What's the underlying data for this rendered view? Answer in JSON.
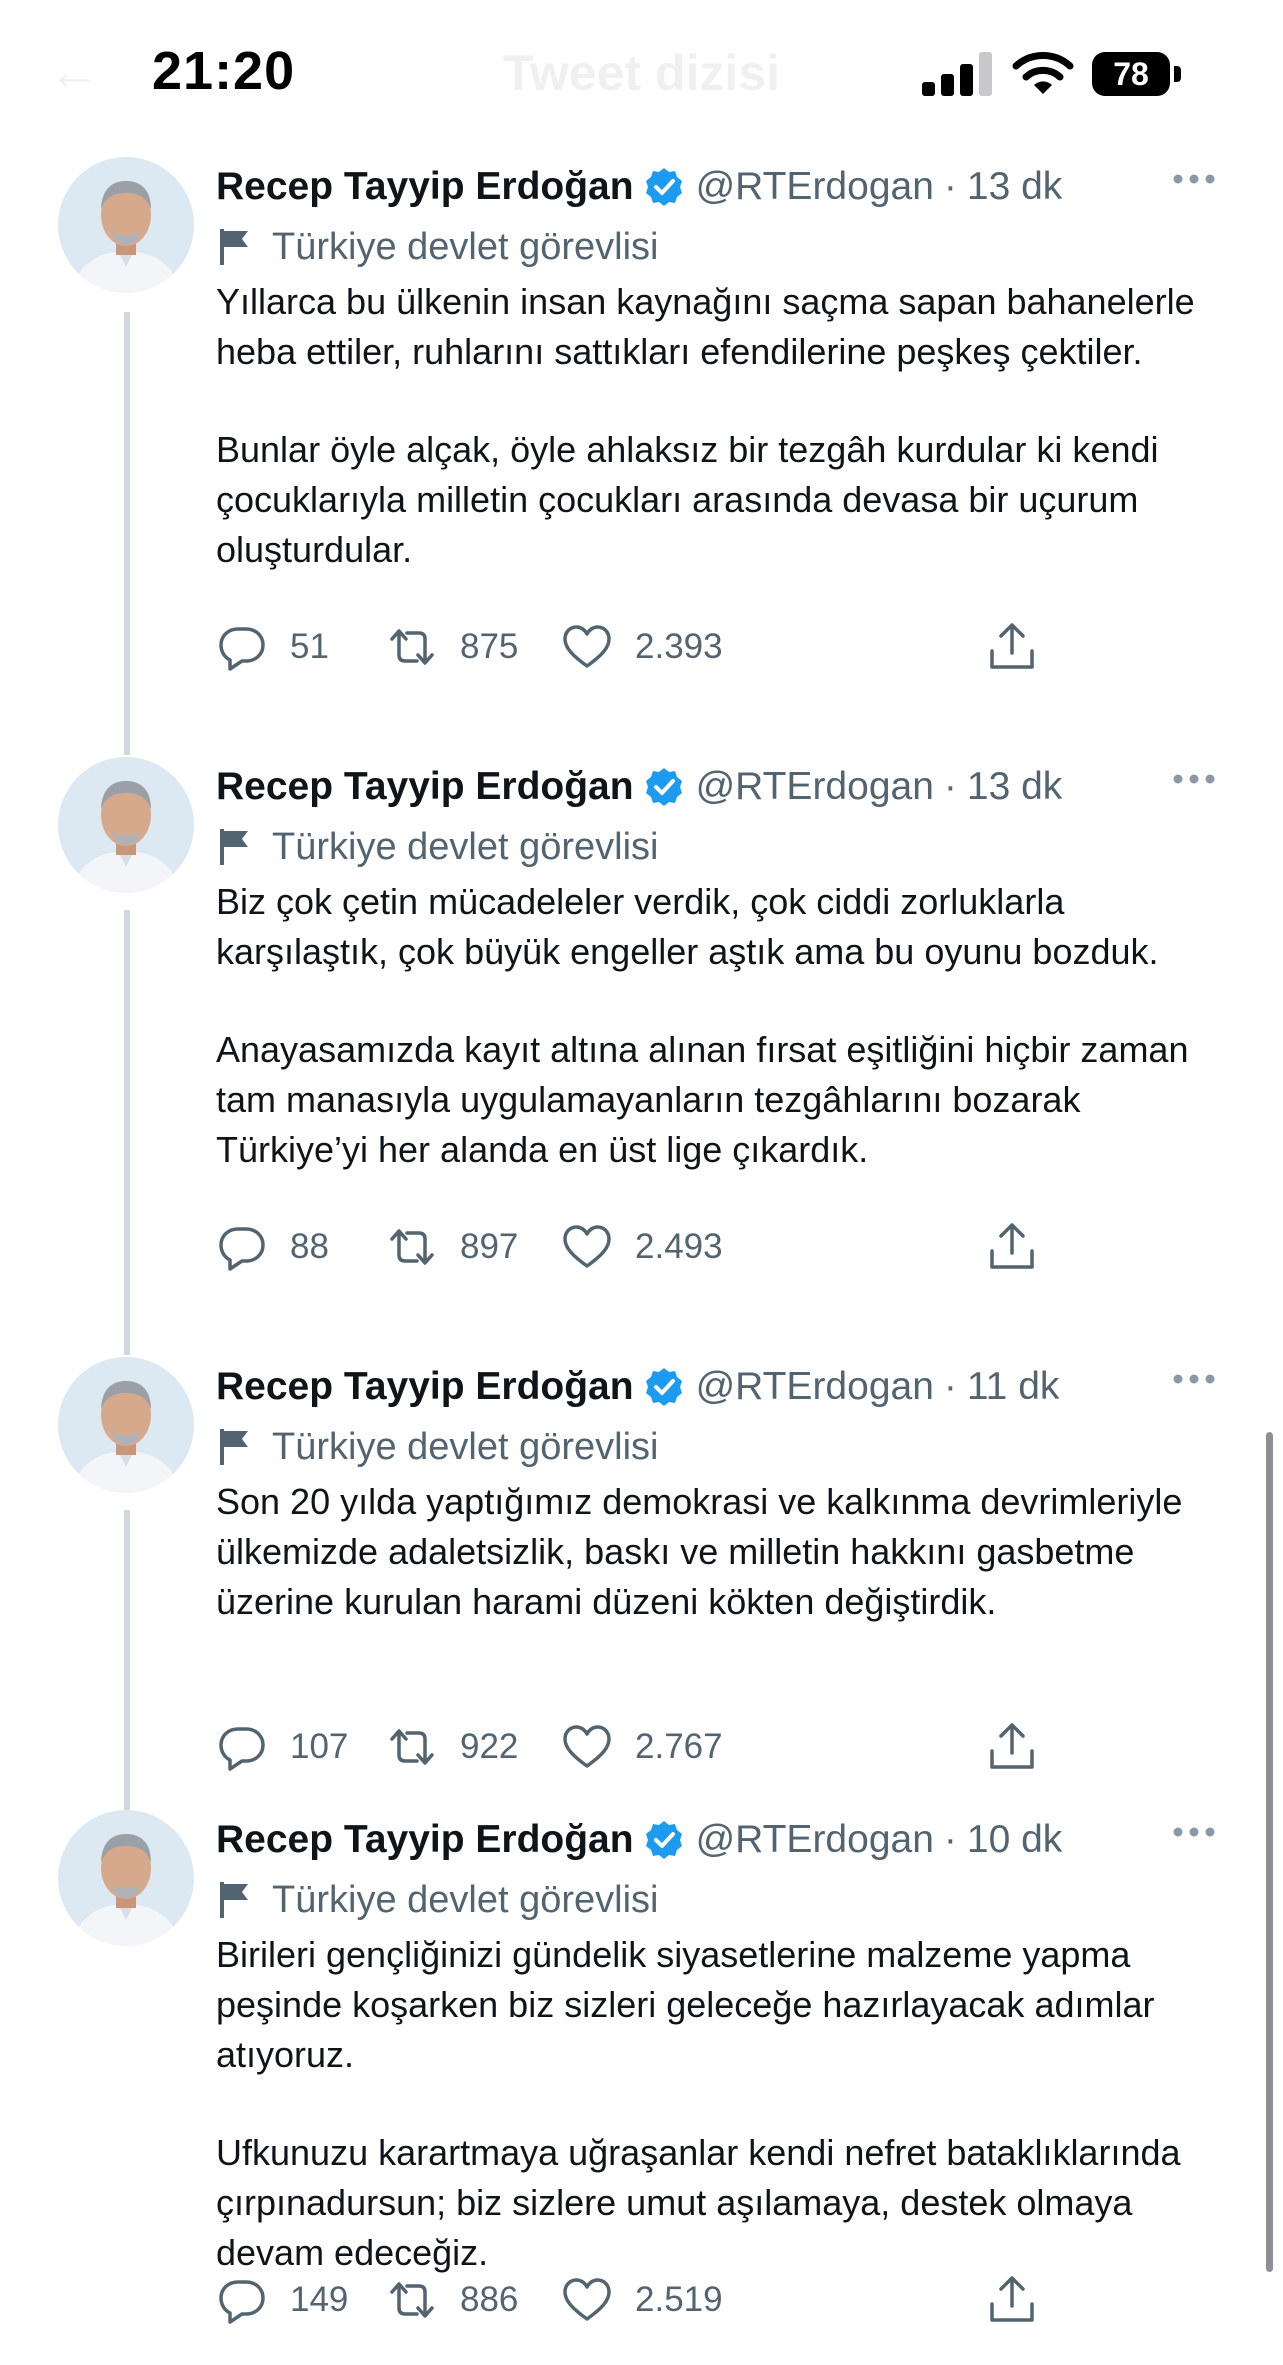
{
  "header": {
    "title": "Tweet dizisi"
  },
  "status_bar": {
    "time": "21:20",
    "battery": "78"
  },
  "tweets": [
    {
      "name": "Recep Tayyip Erdoğan",
      "handle": "@RTErdogan",
      "separator": "·",
      "time": "13 dk",
      "label": "Türkiye devlet görevlisi",
      "paragraphs": [
        "Yıllarca bu ülkenin insan kaynağını saçma sapan bahanelerle heba ettiler, ruhlarını sattıkları efendilerine peşkeş çektiler.",
        "Bunlar öyle alçak, öyle ahlaksız bir tezgâh kurdular ki kendi çocuklarıyla milletin çocukları arasında devasa bir uçurum oluşturdular."
      ],
      "replies": "51",
      "retweets": "875",
      "likes": "2.393"
    },
    {
      "name": "Recep Tayyip Erdoğan",
      "handle": "@RTErdogan",
      "separator": "·",
      "time": "13 dk",
      "label": "Türkiye devlet görevlisi",
      "paragraphs": [
        "Biz çok çetin mücadeleler verdik, çok ciddi zorluklarla karşılaştık, çok büyük engeller aştık ama bu oyunu bozduk.",
        "Anayasamızda kayıt altına alınan fırsat eşitliğini hiçbir zaman tam manasıyla uygulamayanların tezgâhlarını bozarak Türkiye’yi her alanda en üst lige çıkardık."
      ],
      "replies": "88",
      "retweets": "897",
      "likes": "2.493"
    },
    {
      "name": "Recep Tayyip Erdoğan",
      "handle": "@RTErdogan",
      "separator": "·",
      "time": "11 dk",
      "label": "Türkiye devlet görevlisi",
      "paragraphs": [
        "Son 20 yılda yaptığımız demokrasi ve kalkınma devrimleriyle ülkemizde adaletsizlik, baskı ve milletin hakkını gasbetme üzerine kurulan harami düzeni kökten değiştirdik."
      ],
      "replies": "107",
      "retweets": "922",
      "likes": "2.767"
    },
    {
      "name": "Recep Tayyip Erdoğan",
      "handle": "@RTErdogan",
      "separator": "·",
      "time": "10 dk",
      "label": "Türkiye devlet görevlisi",
      "paragraphs": [
        "Birileri gençliğinizi gündelik siyasetlerine malzeme yapma peşinde koşarken biz sizleri geleceğe hazırlayacak adımlar atıyoruz.",
        "Ufkunuzu karartmaya uğraşanlar kendi nefret bataklıklarında çırpınadursun; biz sizlere umut aşılamaya, destek olmaya devam edeceğiz."
      ],
      "replies": "149",
      "retweets": "886",
      "likes": "2.519"
    }
  ],
  "icons": {
    "verified": "verified-badge-icon",
    "label": "flag-icon",
    "reply": "comment-icon",
    "retweet": "retweet-icon",
    "like": "heart-icon",
    "share": "share-icon",
    "more": "more-dots-icon"
  },
  "colors": {
    "verified": "#1d9bf0",
    "secondary_text": "#536471",
    "thread_line": "#cfd9de",
    "text": "#0f1419"
  }
}
